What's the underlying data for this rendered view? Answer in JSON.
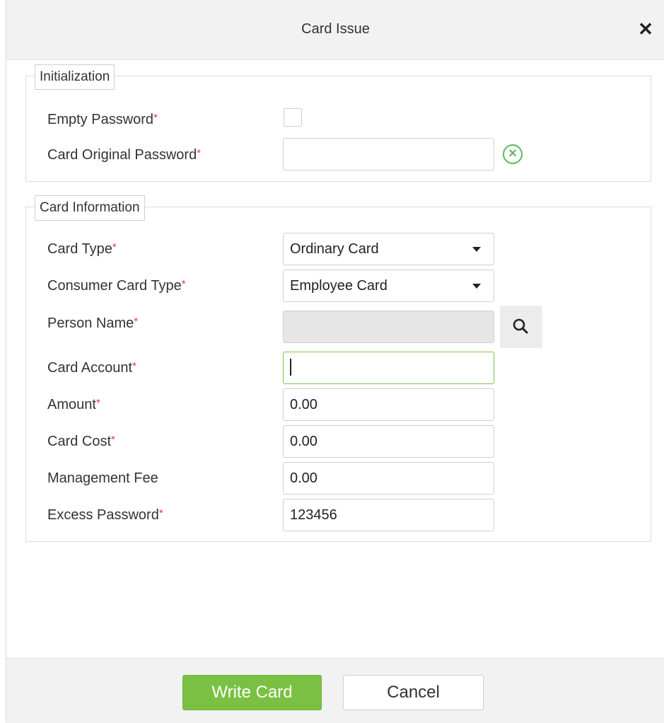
{
  "dialog": {
    "title": "Card Issue",
    "close_label": "✕"
  },
  "initialization": {
    "legend": "Initialization",
    "empty_password_label": "Empty Password",
    "empty_password_checked": false,
    "card_original_password_label": "Card Original Password",
    "card_original_password_value": ""
  },
  "card_information": {
    "legend": "Card Information",
    "card_type_label": "Card Type",
    "card_type_value": "Ordinary Card",
    "consumer_card_type_label": "Consumer Card Type",
    "consumer_card_type_value": "Employee Card",
    "person_name_label": "Person Name",
    "person_name_value": "",
    "card_account_label": "Card Account",
    "card_account_value": "",
    "amount_label": "Amount",
    "amount_value": "0.00",
    "card_cost_label": "Card Cost",
    "card_cost_value": "0.00",
    "management_fee_label": "Management Fee",
    "management_fee_value": "0.00",
    "excess_password_label": "Excess Password",
    "excess_password_value": "123456"
  },
  "required_mark": "*",
  "footer": {
    "write_card_label": "Write Card",
    "cancel_label": "Cancel"
  },
  "colors": {
    "primary_green": "#7ac143",
    "required_red": "#e03c3c",
    "focus_green": "#7bc444"
  }
}
